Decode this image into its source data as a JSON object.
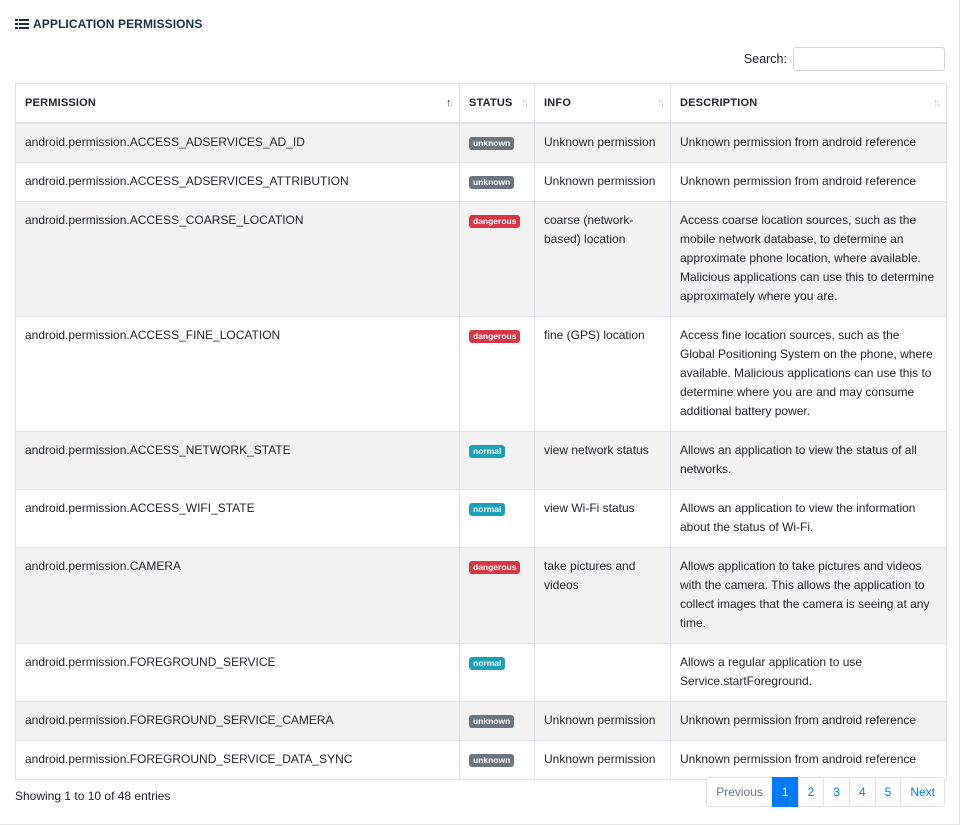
{
  "card": {
    "title": "APPLICATION PERMISSIONS"
  },
  "search": {
    "label": "Search:",
    "value": "",
    "placeholder": ""
  },
  "table": {
    "headers": [
      "PERMISSION",
      "STATUS",
      "INFO",
      "DESCRIPTION"
    ],
    "rows": [
      {
        "permission": "android.permission.ACCESS_ADSERVICES_AD_ID",
        "status": "unknown",
        "info": "Unknown permission",
        "description": "Unknown permission from android reference"
      },
      {
        "permission": "android.permission.ACCESS_ADSERVICES_ATTRIBUTION",
        "status": "unknown",
        "info": "Unknown permission",
        "description": "Unknown permission from android reference"
      },
      {
        "permission": "android.permission.ACCESS_COARSE_LOCATION",
        "status": "dangerous",
        "info": "coarse (network-based) location",
        "description": "Access coarse location sources, such as the mobile network database, to determine an approximate phone location, where available. Malicious applications can use this to determine approximately where you are."
      },
      {
        "permission": "android.permission.ACCESS_FINE_LOCATION",
        "status": "dangerous",
        "info": "fine (GPS) location",
        "description": "Access fine location sources, such as the Global Positioning System on the phone, where available. Malicious applications can use this to determine where you are and may consume additional battery power."
      },
      {
        "permission": "android.permission.ACCESS_NETWORK_STATE",
        "status": "normal",
        "info": "view network status",
        "description": "Allows an application to view the status of all networks."
      },
      {
        "permission": "android.permission.ACCESS_WIFI_STATE",
        "status": "normal",
        "info": "view Wi-Fi status",
        "description": "Allows an application to view the information about the status of Wi-Fi."
      },
      {
        "permission": "android.permission.CAMERA",
        "status": "dangerous",
        "info": "take pictures and videos",
        "description": "Allows application to take pictures and videos with the camera. This allows the application to collect images that the camera is seeing at any time."
      },
      {
        "permission": "android.permission.FOREGROUND_SERVICE",
        "status": "normal",
        "info": "",
        "description": "Allows a regular application to use Service.startForeground."
      },
      {
        "permission": "android.permission.FOREGROUND_SERVICE_CAMERA",
        "status": "unknown",
        "info": "Unknown permission",
        "description": "Unknown permission from android reference"
      },
      {
        "permission": "android.permission.FOREGROUND_SERVICE_DATA_SYNC",
        "status": "unknown",
        "info": "Unknown permission",
        "description": "Unknown permission from android reference"
      }
    ]
  },
  "footer": {
    "info": "Showing 1 to 10 of 48 entries"
  },
  "pagination": {
    "previous": "Previous",
    "pages": [
      "1",
      "2",
      "3",
      "4",
      "5"
    ],
    "next": "Next"
  },
  "colors": {
    "unknown": "#6c757d",
    "dangerous": "#dc3545",
    "normal": "#17a2b8",
    "primary": "#007bff"
  },
  "icons": {
    "title": "list-icon",
    "sort": "sort-arrows-icon"
  }
}
